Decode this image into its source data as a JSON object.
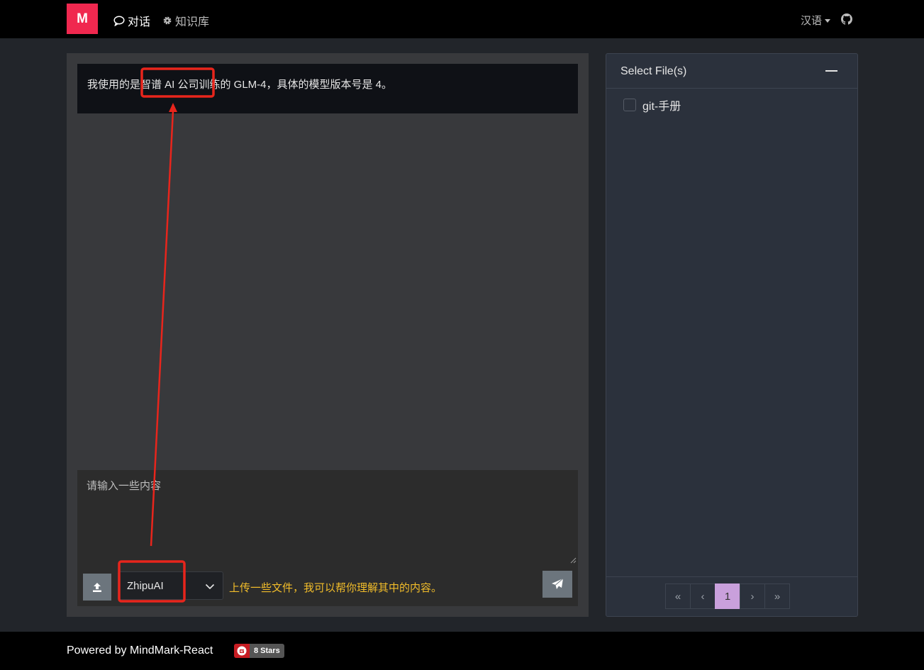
{
  "navbar": {
    "logo": "M",
    "chat_label": "对话",
    "kb_label": "知识库",
    "language": "汉语"
  },
  "chat": {
    "message": "我使用的是智谱 AI 公司训练的 GLM-4，具体的模型版本号是 4。",
    "input_placeholder": "请输入一些内容",
    "model_selected": "ZhipuAI",
    "hint": "上传一些文件，我可以帮你理解其中的内容。"
  },
  "files": {
    "title": "Select File(s)",
    "items": [
      {
        "label": "git-手册",
        "checked": false
      }
    ],
    "pagination": {
      "first": "«",
      "prev": "‹",
      "current": "1",
      "next": "›",
      "last": "»"
    }
  },
  "footer": {
    "powered_by": "Powered by MindMark-React",
    "stars": "8 Stars"
  },
  "colors": {
    "brand": "#f0284f",
    "hint": "#f2bd2a",
    "page_active": "#c9a0dc",
    "annotation": "#e8251c"
  }
}
